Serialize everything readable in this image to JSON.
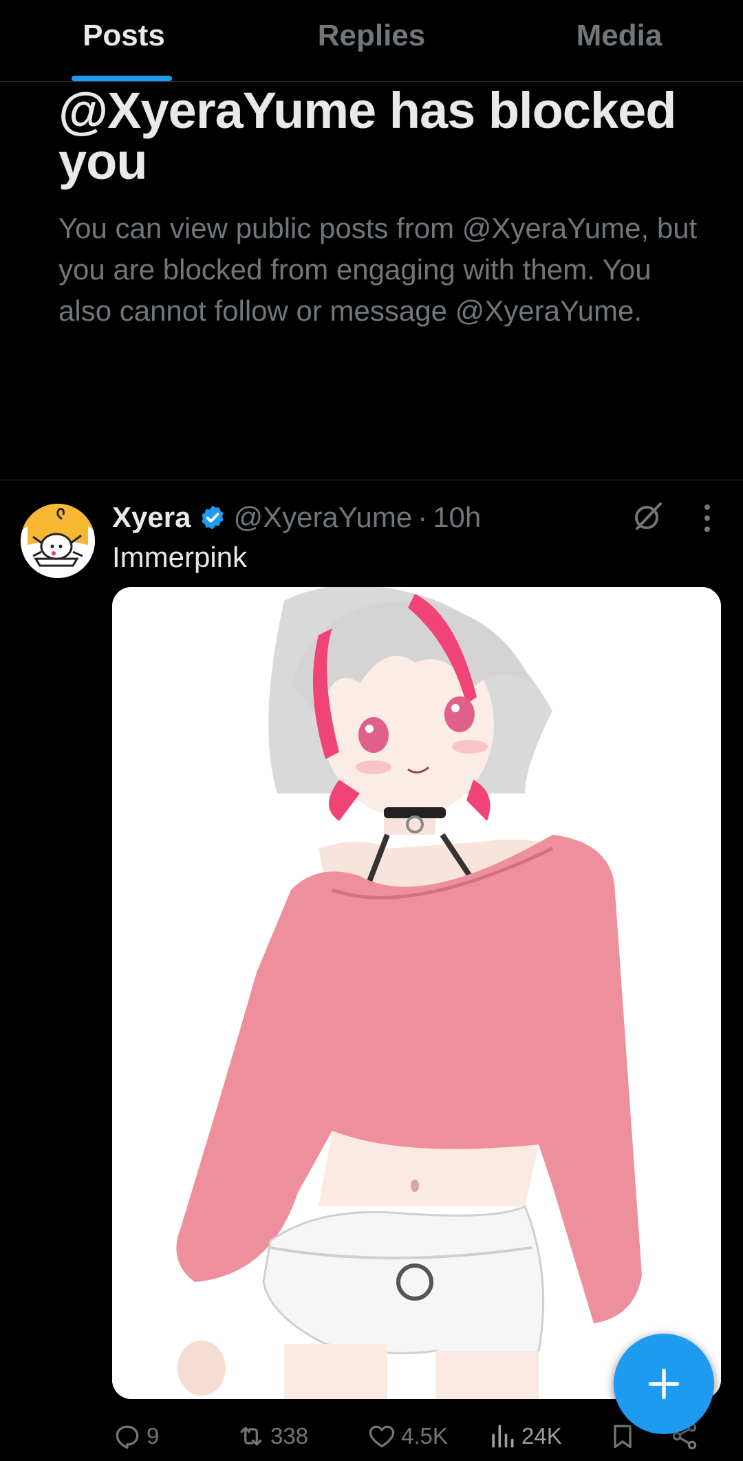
{
  "tabs": [
    {
      "label": "Posts",
      "active": true
    },
    {
      "label": "Replies",
      "active": false
    },
    {
      "label": "Media",
      "active": false
    }
  ],
  "blocked": {
    "title": "@XyeraYume has blocked you",
    "body": "You can view public posts from @XyeraYume, but you are blocked from engaging with them. You also cannot follow or message @XyeraYume."
  },
  "post": {
    "author_name": "Xyera",
    "verified": true,
    "handle": "@XyeraYume",
    "separator": "·",
    "time": "10h",
    "text": "Immerpink",
    "media_icon": "anime-illustration-image",
    "metrics": {
      "replies": "9",
      "reposts": "338",
      "likes": "4.5K",
      "views": "24K"
    }
  },
  "icons": {
    "reply": "reply-icon",
    "repost": "repost-icon",
    "like": "like-icon",
    "views": "views-icon",
    "bookmark": "bookmark-icon",
    "share": "share-icon",
    "grok": "grok-icon",
    "more": "more-icon",
    "compose": "plus-icon"
  },
  "colors": {
    "background": "#000000",
    "accent": "#1d9bf0",
    "text_primary": "#e7e9ea",
    "text_secondary": "#71767b",
    "divider": "#2f3336"
  }
}
